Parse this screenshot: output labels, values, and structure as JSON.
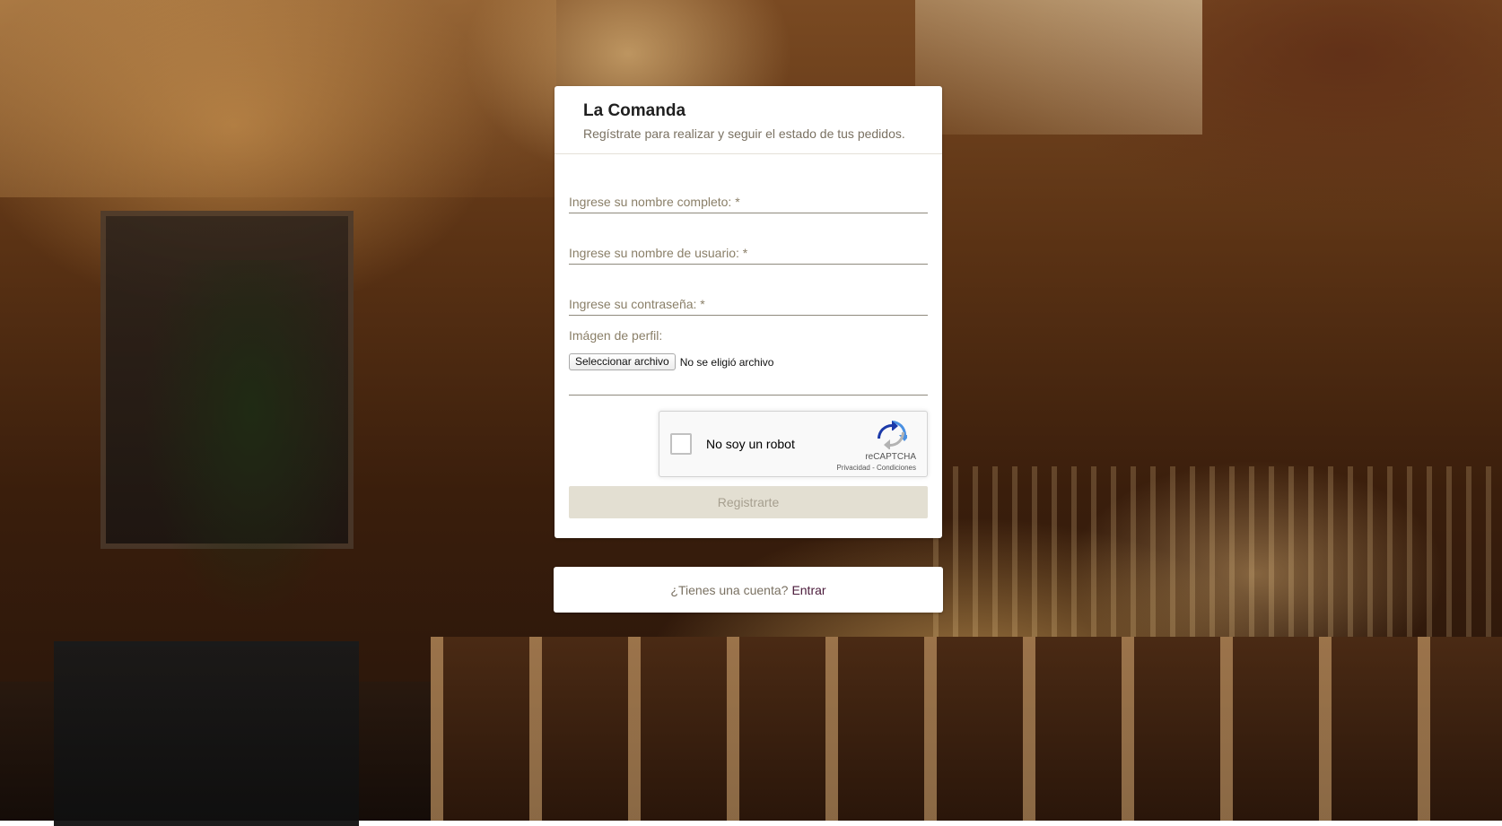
{
  "header": {
    "title": "La Comanda",
    "subtitle": "Regístrate para realizar y seguir el estado de tus pedidos."
  },
  "form": {
    "full_name_label": "Ingrese su nombre completo: *",
    "username_label": "Ingrese su nombre de usuario: *",
    "password_label": "Ingrese su contraseña: *",
    "profile_image_label": "Imágen de perfil:",
    "file_button_label": "Seleccionar archivo",
    "file_status": "No se eligió archivo",
    "submit_label": "Registrarte"
  },
  "recaptcha": {
    "checkbox_label": "No soy un robot",
    "brand": "reCAPTCHA",
    "privacy_link": "Privacidad",
    "separator": " - ",
    "terms_link": "Condiciones",
    "checked": false
  },
  "login": {
    "question": "¿Tienes una cuenta?",
    "link_label": "Entrar"
  },
  "colors": {
    "link": "#4a1a3a",
    "submit_disabled_bg": "#e3dfd2",
    "label": "#8a7f68"
  },
  "icons": {
    "recaptcha_logo": "recaptcha-logo-icon"
  }
}
